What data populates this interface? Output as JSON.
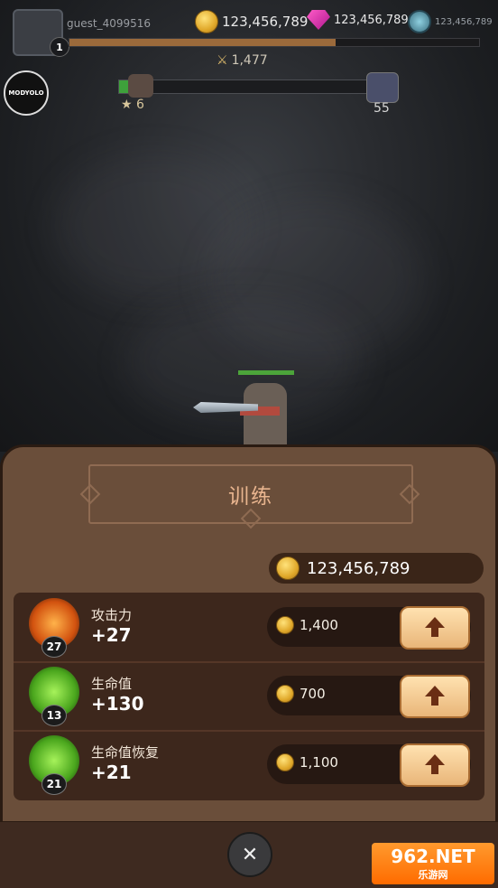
{
  "player": {
    "username": "guest_4099516",
    "level": "1",
    "xp_progress": 0.65
  },
  "currencies": {
    "gold": "123,456,789",
    "gems": "123,456,789",
    "tokens": "123,456,789"
  },
  "combat_power": "1,477",
  "badge": {
    "label": "MODYOLO"
  },
  "stage": {
    "stars": "6",
    "target": "55",
    "progress": 0.05
  },
  "panel": {
    "title": "训练",
    "gold_total": "123,456,789",
    "stats": [
      {
        "name": "攻击力",
        "bonus": "+27",
        "level": "27",
        "cost": "1,400",
        "icon": "sword-burst-icon",
        "color": "#f0751c"
      },
      {
        "name": "生命值",
        "bonus": "+130",
        "level": "13",
        "cost": "700",
        "icon": "heart-icon",
        "color": "#7ad236"
      },
      {
        "name": "生命值恢复",
        "bonus": "+21",
        "level": "21",
        "cost": "1,100",
        "icon": "heart-regen-icon",
        "color": "#7ad236"
      }
    ]
  },
  "close_symbol": "✕",
  "watermark": {
    "line1": "962.NET",
    "line2": "乐游网"
  }
}
